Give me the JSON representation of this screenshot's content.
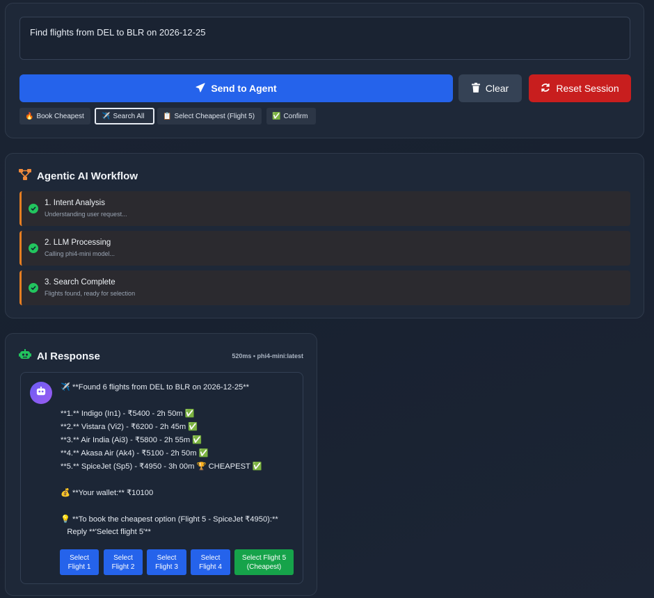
{
  "input": {
    "query": "Find flights from DEL to BLR on 2026-12-25"
  },
  "actions": {
    "send_label": "Send to Agent",
    "clear_label": "Clear",
    "reset_label": "Reset Session"
  },
  "quick_actions": [
    {
      "icon": "🔥",
      "label": "Book Cheapest"
    },
    {
      "icon": "✈️",
      "label": "Search All"
    },
    {
      "icon": "📋",
      "label": "Select Cheapest (Flight 5)"
    },
    {
      "icon": "✅",
      "label": "Confirm"
    }
  ],
  "workflow": {
    "title": "Agentic AI Workflow",
    "steps": [
      {
        "title": "1. Intent Analysis",
        "desc": "Understanding user request..."
      },
      {
        "title": "2. LLM Processing",
        "desc": "Calling phi4-mini model..."
      },
      {
        "title": "3. Search Complete",
        "desc": "Flights found, ready for selection"
      }
    ]
  },
  "response": {
    "title": "AI Response",
    "meta": "520ms • phi4-mini:latest",
    "lines": [
      "✈️ **Found 6 flights from DEL to BLR on 2026-12-25**",
      "**1.** Indigo (In1) - ₹5400 - 2h 50m ✅",
      "**2.** Vistara (Vi2) - ₹6200 - 2h 45m ✅",
      "**3.** Air India (Ai3) - ₹5800 - 2h 55m ✅",
      "**4.** Akasa Air (Ak4) - ₹5100 - 2h 50m ✅",
      "**5.** SpiceJet (Sp5) - ₹4950 - 3h 00m 🏆 CHEAPEST ✅",
      "💰 **Your wallet:** ₹10100",
      "💡 **To book the cheapest option (Flight 5 - SpiceJet ₹4950):**",
      "   Reply **'Select flight 5'**"
    ],
    "choices": [
      {
        "line1": "Select",
        "line2": "Flight 1"
      },
      {
        "line1": "Select",
        "line2": "Flight 2"
      },
      {
        "line1": "Select",
        "line2": "Flight 3"
      },
      {
        "line1": "Select",
        "line2": "Flight 4"
      },
      {
        "line1": "Select Flight 5",
        "line2": "(Cheapest)"
      }
    ]
  },
  "colors": {
    "primary": "#2563eb",
    "danger": "#c81e1e",
    "success": "#16a34a",
    "step_accent": "#e67e22"
  },
  "icons": {
    "send": "paper-plane-icon",
    "clear": "trash-icon",
    "reset": "refresh-icon",
    "workflow": "workflow-icon",
    "robot": "robot-icon",
    "check": "check-circle-icon"
  }
}
